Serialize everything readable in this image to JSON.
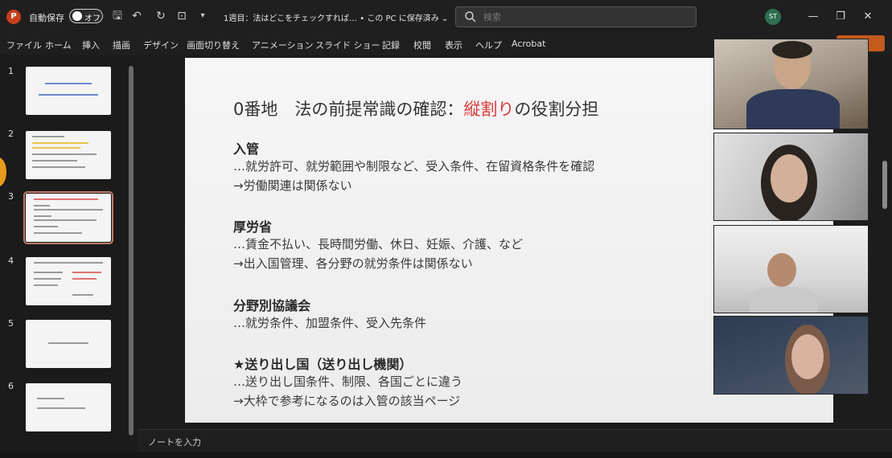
{
  "titlebar": {
    "autosave_label": "自動保存",
    "autosave_state": "オフ",
    "document_title": "1週目：法はどこをチェックすれば…  •  この PC に保存済み ⌄",
    "search_placeholder": "検索",
    "user_initials": "ST",
    "accent_color": "#c43e1c"
  },
  "ribbon": {
    "tabs": [
      "ファイル",
      "ホーム",
      "挿入",
      "描画",
      "デザイン",
      "画面切り替え",
      "アニメーション",
      "スライド ショー",
      "記録",
      "校閲",
      "表示",
      "ヘルプ",
      "Acrobat"
    ]
  },
  "thumbnails": {
    "numbers": [
      "1",
      "2",
      "3",
      "4",
      "5",
      "6"
    ],
    "selected": "3"
  },
  "slide": {
    "title_prefix": "0番地　法の前提常識の確認：",
    "title_highlight": "縦割り",
    "title_suffix": "の役割分担",
    "sections": [
      {
        "heading": "入管",
        "lines": [
          "…就労許可、就労範囲や制限など、受入条件、在留資格条件を確認",
          "→労働関連は関係ない"
        ]
      },
      {
        "heading": "厚労省",
        "lines": [
          "…賃金不払い、長時間労働、休日、妊娠、介護、など",
          "→出入国管理、各分野の就労条件は関係ない"
        ]
      },
      {
        "heading": "分野別協議会",
        "lines": [
          "…就労条件、加盟条件、受入先条件"
        ]
      },
      {
        "heading": "★送り出し国（送り出し機関）",
        "lines": [
          "…送り出し国条件、制限、各国ごとに違う",
          "→大枠で参考になるのは入管の該当ページ"
        ]
      }
    ]
  },
  "notes": {
    "placeholder": "ノートを入力"
  }
}
